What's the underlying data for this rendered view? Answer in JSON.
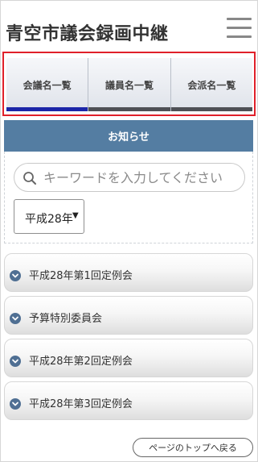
{
  "header": {
    "title": "青空市議会録画中継",
    "menu_icon": "hamburger-icon"
  },
  "tabs": [
    {
      "label": "会議名一覧",
      "active": true
    },
    {
      "label": "議員名一覧",
      "active": false
    },
    {
      "label": "会派名一覧",
      "active": false
    }
  ],
  "notice": {
    "label": "お知らせ"
  },
  "search": {
    "placeholder": "キーワードを入力してください",
    "value": "",
    "icon": "search-icon"
  },
  "era_select": {
    "selected": "平成28年",
    "arrow": "▼"
  },
  "meetings": [
    {
      "label": "平成28年第1回定例会"
    },
    {
      "label": "予算特別委員会"
    },
    {
      "label": "平成28年第2回定例会"
    },
    {
      "label": "平成28年第3回定例会"
    }
  ],
  "footer": {
    "to_top_label": "ページのトップへ戻る"
  },
  "colors": {
    "notice_bar": "#547da2",
    "active_tab_underline": "#1c26a8",
    "tab_underline": "#4e5055",
    "highlight_border": "#e0202a",
    "accordion_icon": "#4f6f93"
  }
}
